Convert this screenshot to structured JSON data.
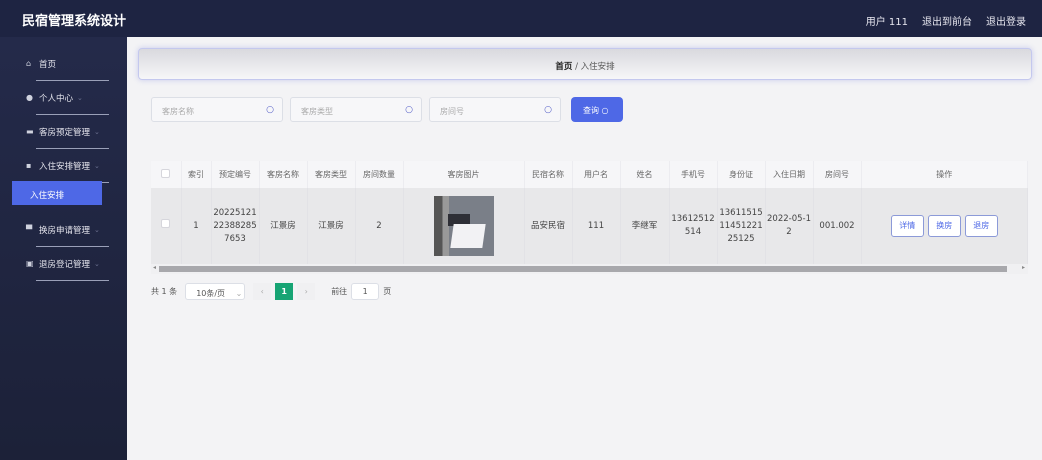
{
  "app": {
    "title": "民宿管理系统设计"
  },
  "header": {
    "user": "用户 111",
    "to_front": "退出到前台",
    "logout": "退出登录"
  },
  "sidebar": {
    "items": [
      {
        "label": "首页",
        "icon": "home-icon",
        "glyph": "⌂",
        "chev": ""
      },
      {
        "label": "个人中心",
        "icon": "user-icon",
        "glyph": "●",
        "chev": "⌄"
      },
      {
        "label": "客房预定管理",
        "icon": "briefcase-icon",
        "glyph": "▬",
        "chev": "⌄"
      },
      {
        "label": "入住安排管理",
        "icon": "grid-icon",
        "glyph": "▪",
        "chev": "⌄"
      },
      {
        "label": "换房申请管理",
        "icon": "monitor-icon",
        "glyph": "▀",
        "chev": "⌄"
      },
      {
        "label": "退房登记管理",
        "icon": "clipboard-icon",
        "glyph": "▣",
        "chev": "⌄"
      }
    ],
    "active_sub": "入住安排"
  },
  "breadcrumb": {
    "home": "首页",
    "sep": "/",
    "current": "入住安排"
  },
  "search": {
    "room_name": "客房名称",
    "room_type": "客房类型",
    "room_no": "房间号",
    "query": "查询"
  },
  "table": {
    "headers": [
      "索引",
      "预定编号",
      "客房名称",
      "客房类型",
      "房间数量",
      "客房图片",
      "民宿名称",
      "用户名",
      "姓名",
      "手机号",
      "身份证",
      "入住日期",
      "房间号",
      "操作"
    ],
    "rows": [
      {
        "index": "1",
        "booking_no": "20225121223882857653",
        "room_name": "江景房",
        "room_type": "江景房",
        "count": "2",
        "homestay": "品安民宿",
        "username": "111",
        "name": "李继军",
        "phone": "13612512514",
        "id_card": "136115151145122125125",
        "date": "2022-05-12",
        "room_no": "001.002"
      }
    ],
    "actions": [
      "详情",
      "换房",
      "退房"
    ]
  },
  "pagination": {
    "total": "共 1 条",
    "page_size": "10条/页",
    "current": "1",
    "goto": "前往",
    "goto_value": "1",
    "page_unit": "页"
  },
  "colors": {
    "accent": "#4e68e6",
    "header": "#1e2442",
    "page_active": "#17a474"
  }
}
